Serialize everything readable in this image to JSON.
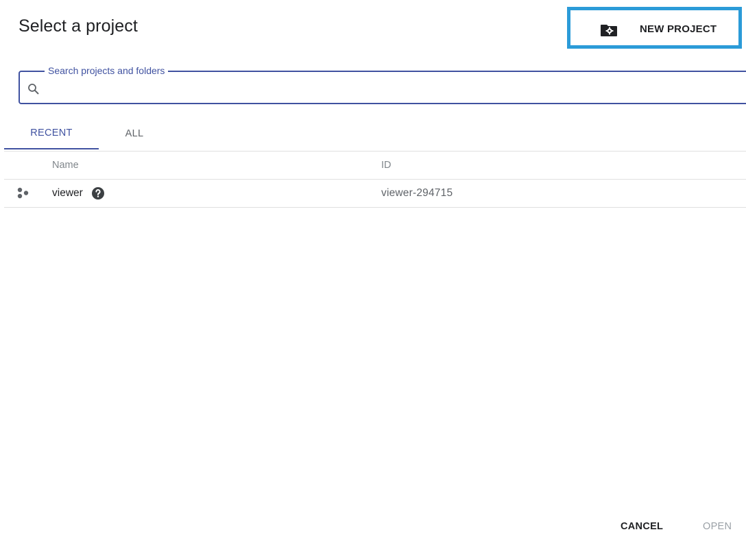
{
  "dialog": {
    "title": "Select a project",
    "new_project_label": "NEW PROJECT",
    "new_project_icon": "folder-settings-icon",
    "highlight_color": "#2b9bd8"
  },
  "search": {
    "label": "Search projects and folders",
    "value": "",
    "icon": "search-icon",
    "accent_color": "#3f51a0"
  },
  "tabs": [
    {
      "label": "RECENT",
      "selected": true
    },
    {
      "label": "ALL",
      "selected": false
    }
  ],
  "table": {
    "columns": {
      "name": "Name",
      "id": "ID"
    },
    "rows": [
      {
        "icon": "project-dots-icon",
        "name": "viewer",
        "help_icon": "help-icon",
        "id": "viewer-294715"
      }
    ]
  },
  "footer": {
    "cancel_label": "CANCEL",
    "open_label": "OPEN"
  }
}
